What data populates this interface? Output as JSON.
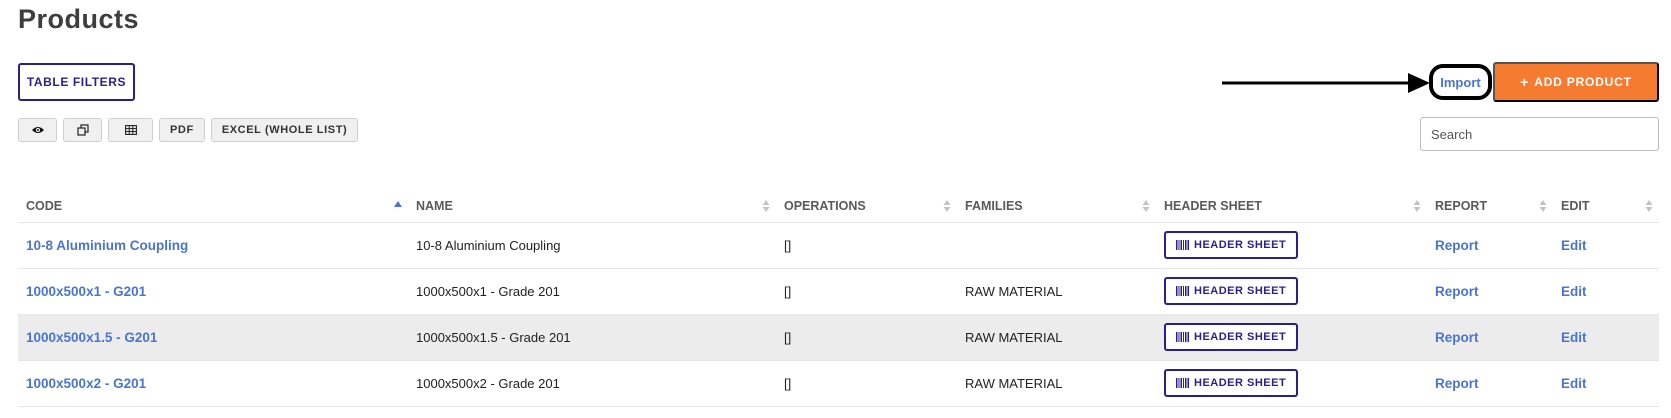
{
  "page": {
    "title": "Products"
  },
  "toolbar": {
    "table_filters_label": "TABLE FILTERS",
    "import_label": "Import",
    "add_product_label": "ADD PRODUCT",
    "export_buttons": [
      {
        "icon": "eye-icon",
        "label": ""
      },
      {
        "icon": "copy-icon",
        "label": ""
      },
      {
        "icon": "table-icon",
        "label": ""
      },
      {
        "icon": "",
        "label": "PDF"
      },
      {
        "icon": "",
        "label": "EXCEL (WHOLE LIST)"
      }
    ],
    "pdf_label": "PDF",
    "excel_label": "EXCEL (WHOLE LIST)"
  },
  "search": {
    "placeholder": "Search",
    "value": ""
  },
  "table": {
    "columns": {
      "code": "CODE",
      "name": "NAME",
      "operations": "OPERATIONS",
      "families": "FAMILIES",
      "header_sheet": "HEADER SHEET",
      "report": "REPORT",
      "edit": "EDIT"
    },
    "sort": {
      "column": "code",
      "direction": "ascending"
    },
    "header_sheet_label": "HEADER SHEET",
    "rows": [
      {
        "code": "10-8 Aluminium Coupling",
        "name": "10-8 Aluminium Coupling",
        "operations": "[]",
        "families": "",
        "header_sheet": "HEADER SHEET",
        "report": "Report",
        "edit": "Edit"
      },
      {
        "code": "1000x500x1 - G201",
        "name": "1000x500x1 - Grade 201",
        "operations": "[]",
        "families": "RAW MATERIAL",
        "header_sheet": "HEADER SHEET",
        "report": "Report",
        "edit": "Edit"
      },
      {
        "code": "1000x500x1.5 - G201",
        "name": "1000x500x1.5 - Grade 201",
        "operations": "[]",
        "families": "RAW MATERIAL",
        "header_sheet": "HEADER SHEET",
        "report": "Report",
        "edit": "Edit"
      },
      {
        "code": "1000x500x2 - G201",
        "name": "1000x500x2 - Grade 201",
        "operations": "[]",
        "families": "RAW MATERIAL",
        "header_sheet": "HEADER SHEET",
        "report": "Report",
        "edit": "Edit"
      }
    ]
  },
  "colors": {
    "accent": "#2a1f8f",
    "link": "#4a74d4",
    "add_button": "#f47b2f",
    "row_highlight": "#ececec"
  }
}
